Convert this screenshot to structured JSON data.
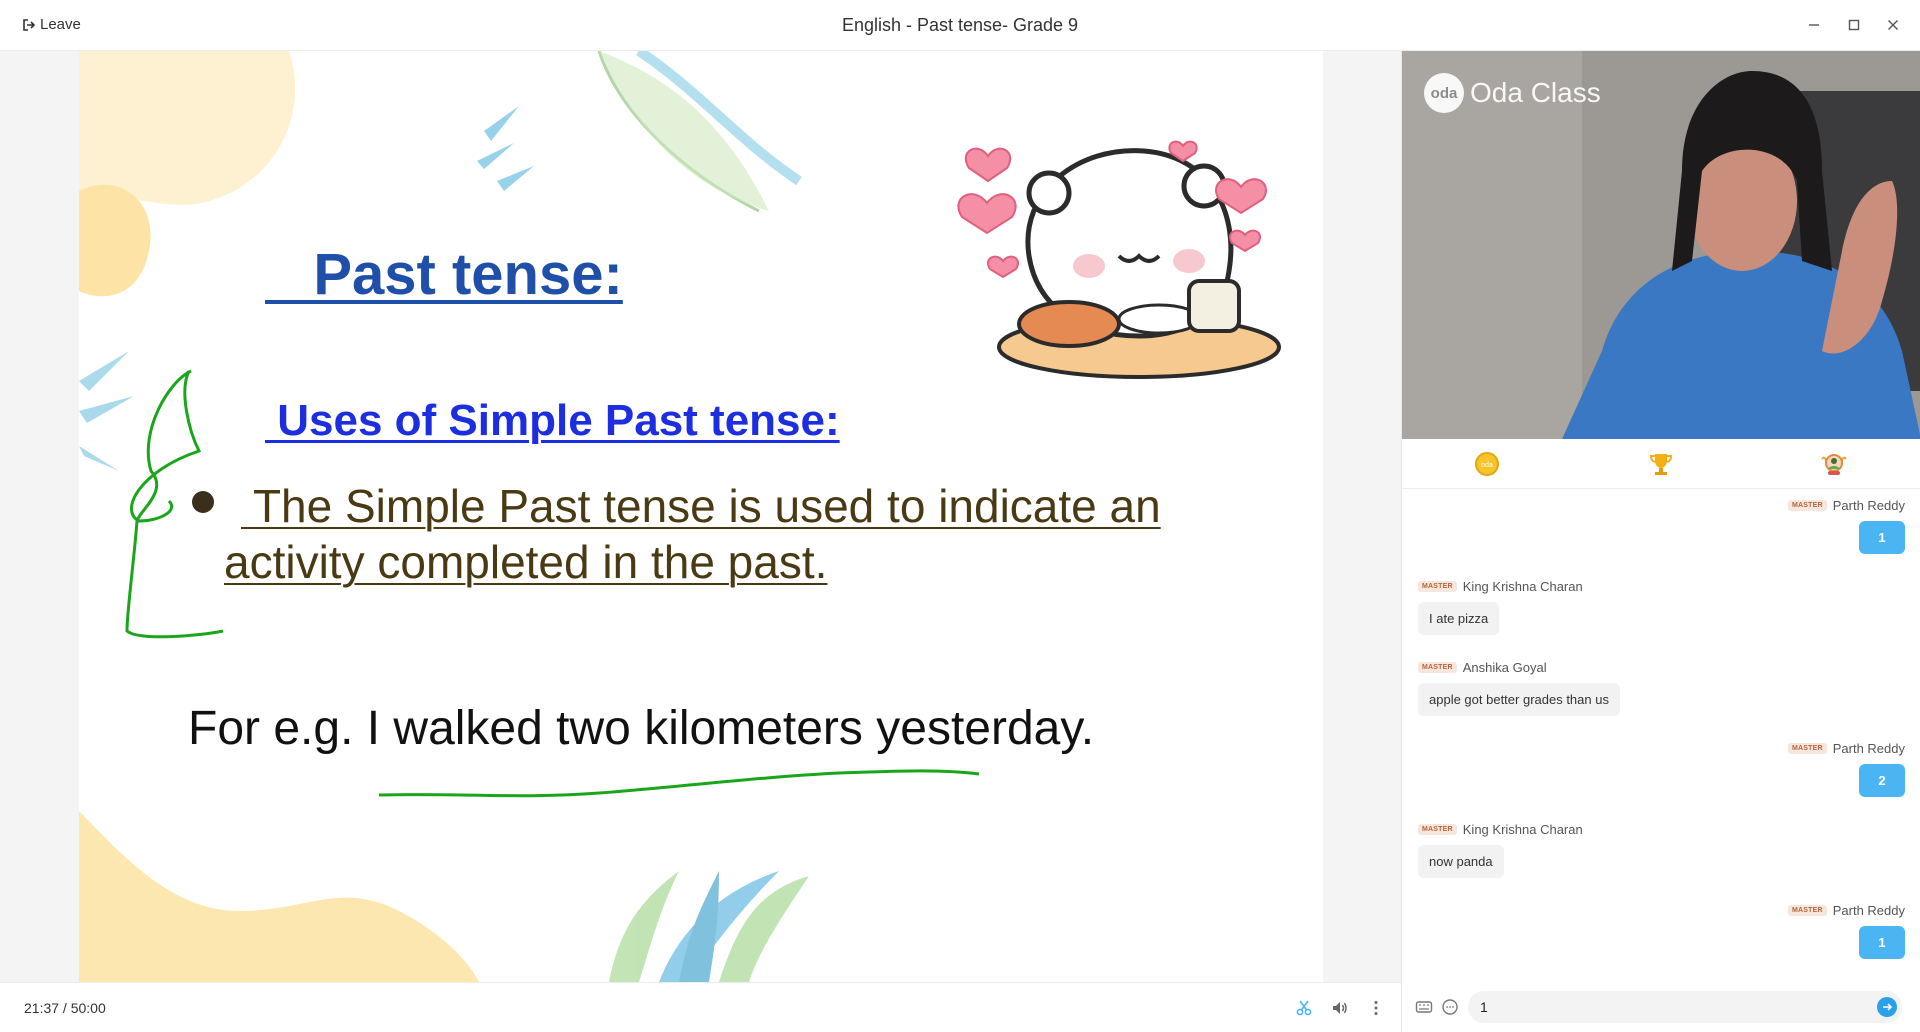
{
  "window": {
    "title": "English - Past tense- Grade 9",
    "leave_label": "Leave"
  },
  "slide": {
    "heading": "   Past tense:",
    "subheading": " Uses of Simple Past tense:",
    "bullet_line1": " The Simple Past tense is used to indicate an",
    "bullet_line2": "activity completed in the past.",
    "example": "For e.g. I walked two kilometers yesterday."
  },
  "player": {
    "elapsed": "21:37",
    "separator": " / ",
    "total": "50:00"
  },
  "video": {
    "brand_logo": "oda",
    "brand_name": "Oda Class"
  },
  "tabs": [
    {
      "name": "coin-icon",
      "color": "#f5b915"
    },
    {
      "name": "trophy-icon",
      "color": "#f5a623"
    },
    {
      "name": "avatar-badge-icon",
      "color": "#e98a2d"
    }
  ],
  "chat": {
    "badge_label": "MASTER",
    "messages": [
      {
        "author": "Parth Reddy",
        "text": "1",
        "side": "right"
      },
      {
        "author": "King Krishna Charan",
        "text": "I ate pizza",
        "side": "left"
      },
      {
        "author": "Anshika Goyal",
        "text": "apple got better grades than us",
        "side": "left"
      },
      {
        "author": "Parth Reddy",
        "text": "2",
        "side": "right"
      },
      {
        "author": "King Krishna Charan",
        "text": "now panda",
        "side": "left"
      },
      {
        "author": "Parth Reddy",
        "text": "1",
        "side": "right"
      }
    ],
    "input_value": "1"
  },
  "colors": {
    "heading_blue": "#1f4fa8",
    "subheading_blue": "#1c2ee0",
    "bullet_brown": "#4a3a14",
    "annotation_green": "#1aa61a",
    "accent_blue": "#4ab5f2"
  }
}
